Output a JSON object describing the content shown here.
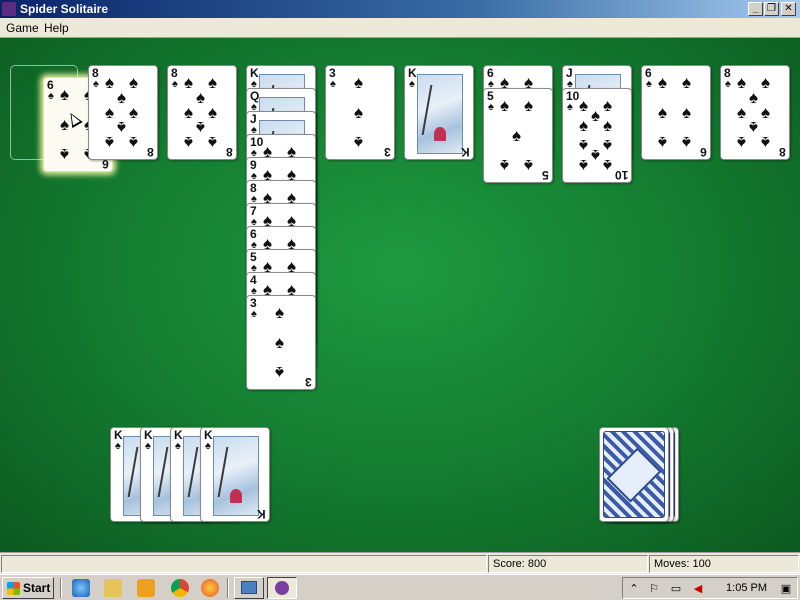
{
  "window": {
    "title": "Spider Solitaire",
    "controls": {
      "minimize": "_",
      "restore": "❐",
      "close": "✕"
    }
  },
  "menu": {
    "items": [
      "Game",
      "Help"
    ]
  },
  "suit_symbol": "♠",
  "tableau": [
    {
      "empty": true,
      "held_card": {
        "rank": "6",
        "selected": true
      }
    },
    {
      "cards": [
        {
          "rank": "8",
          "face": "number"
        }
      ]
    },
    {
      "cards": [
        {
          "rank": "8",
          "face": "number"
        }
      ]
    },
    {
      "cards": [
        {
          "rank": "K",
          "face": "court"
        },
        {
          "rank": "Q",
          "face": "court"
        },
        {
          "rank": "J",
          "face": "court"
        },
        {
          "rank": "10",
          "face": "number"
        },
        {
          "rank": "9",
          "face": "number"
        },
        {
          "rank": "8",
          "face": "number"
        },
        {
          "rank": "7",
          "face": "number"
        },
        {
          "rank": "6",
          "face": "number"
        },
        {
          "rank": "5",
          "face": "number"
        },
        {
          "rank": "4",
          "face": "number"
        },
        {
          "rank": "3",
          "face": "number"
        }
      ]
    },
    {
      "cards": [
        {
          "rank": "3",
          "face": "number"
        }
      ]
    },
    {
      "cards": [
        {
          "rank": "K",
          "face": "court"
        }
      ]
    },
    {
      "cards": [
        {
          "rank": "6",
          "face": "number"
        },
        {
          "rank": "5",
          "face": "number"
        }
      ]
    },
    {
      "cards": [
        {
          "rank": "J",
          "face": "court"
        },
        {
          "rank": "10",
          "face": "number"
        }
      ]
    },
    {
      "cards": [
        {
          "rank": "6",
          "face": "number"
        }
      ]
    },
    {
      "cards": [
        {
          "rank": "8",
          "face": "number"
        }
      ]
    }
  ],
  "completed_stacks": {
    "ranks": [
      "K",
      "K",
      "K",
      "K"
    ]
  },
  "stock": {
    "remaining_deals": 3
  },
  "status": {
    "score_label": "Score: 800",
    "moves_label": "Moves:  100",
    "score": 800,
    "moves": 100
  },
  "taskbar": {
    "start_label": "Start",
    "clock": "1:05 PM",
    "quick_launch": [
      "internet-explorer-icon",
      "folder-icon",
      "media-player-icon",
      "chrome-icon",
      "firefox-icon"
    ],
    "tasks": [
      "remote-desktop-task",
      "spider-solitaire-task"
    ],
    "tray_icons": [
      "chevron-up-icon",
      "flag-icon",
      "network-icon",
      "volume-muted-icon",
      "monitor-icon"
    ]
  },
  "colors": {
    "felt": "#137a2f",
    "title_bar": "#0a246a",
    "card_back": "#3b5ba8",
    "selection_glow": "#ffffaa"
  }
}
